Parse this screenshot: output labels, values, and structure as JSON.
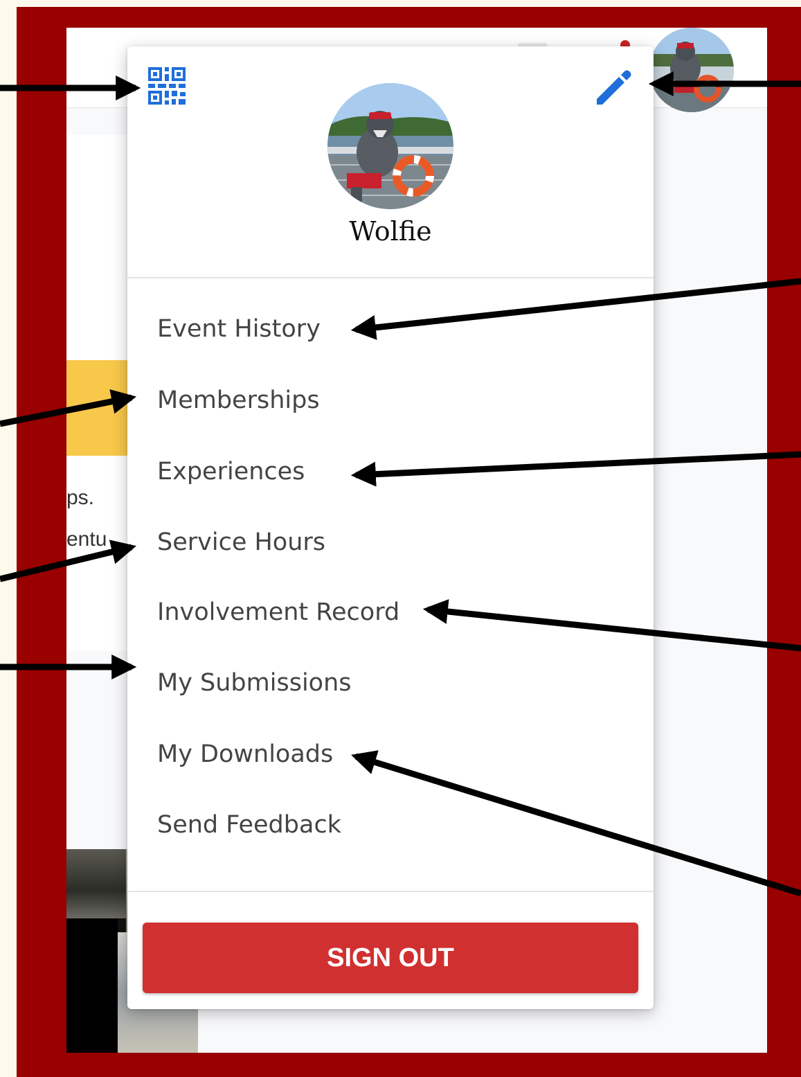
{
  "profile": {
    "name": "Wolfie",
    "edit_icon": "pencil-icon",
    "qr_icon": "qr-code-icon"
  },
  "menu": {
    "items": [
      {
        "label": "Event History"
      },
      {
        "label": "Memberships"
      },
      {
        "label": "Experiences"
      },
      {
        "label": "Service Hours"
      },
      {
        "label": "Involvement Record"
      },
      {
        "label": "My Submissions"
      },
      {
        "label": "My Downloads"
      },
      {
        "label": "Send Feedback"
      }
    ],
    "sign_out_label": "SIGN OUT"
  },
  "background": {
    "text_line_1": "ps.",
    "text_line_2": "entu"
  },
  "colors": {
    "frame": "#990000",
    "accent_blue": "#1e6fd9",
    "sign_out": "#d13030",
    "banner_yellow": "#f8c84a"
  }
}
